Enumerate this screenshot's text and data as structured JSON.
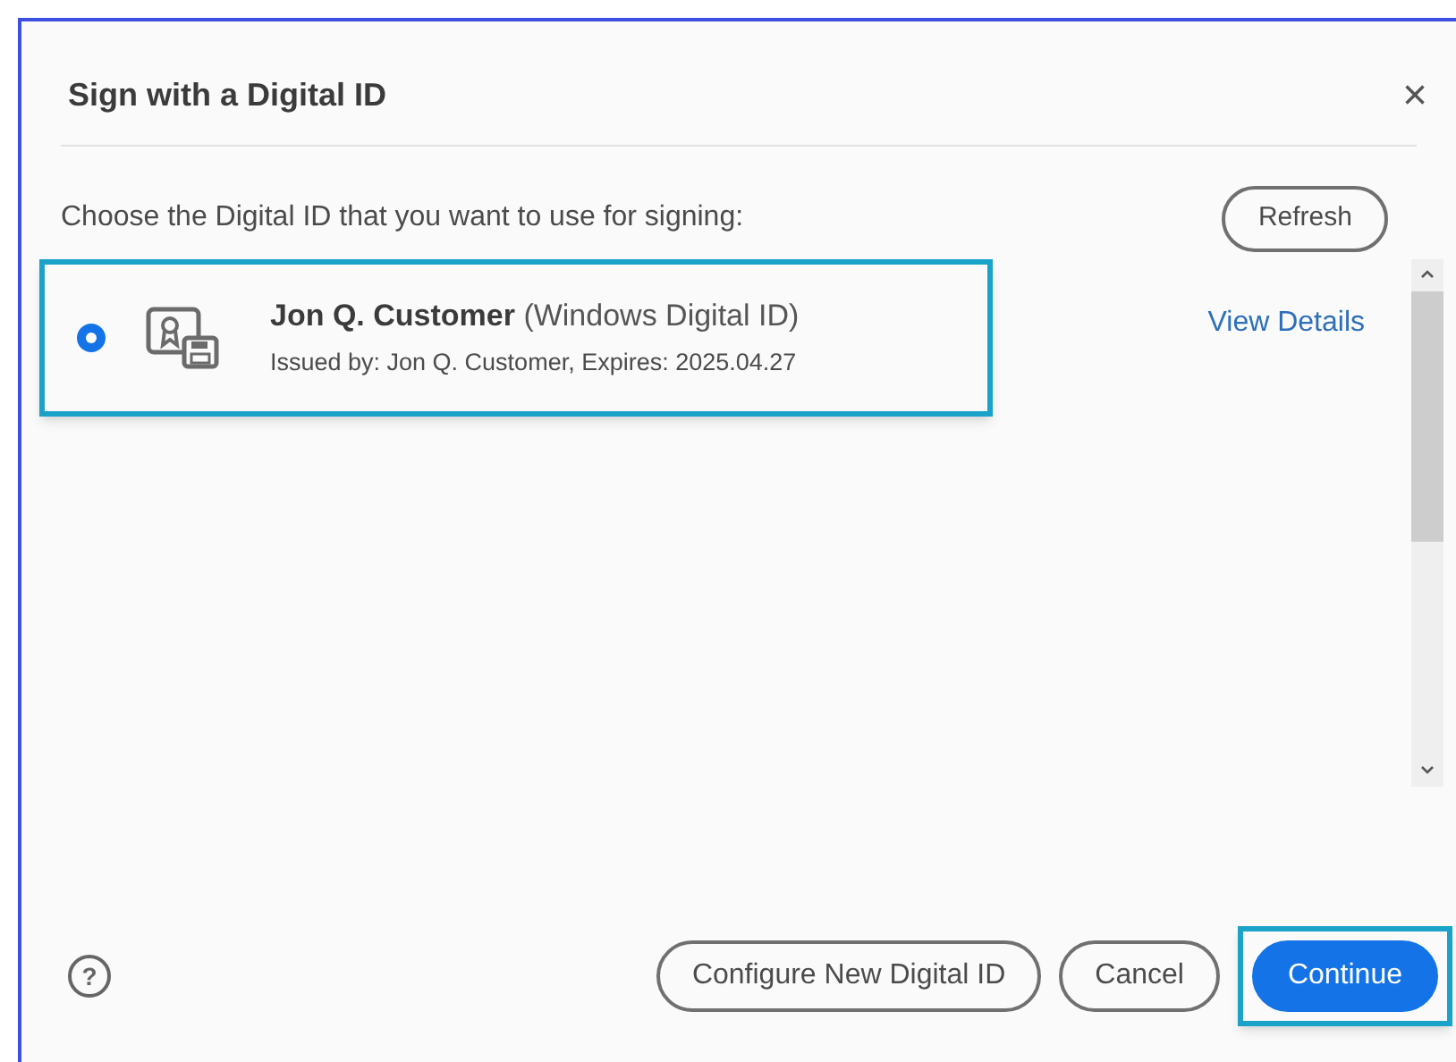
{
  "dialog": {
    "title": "Sign with a Digital ID",
    "close": "×"
  },
  "prompt": "Choose the Digital ID that you want to use for signing:",
  "refresh_button": "Refresh",
  "ids": [
    {
      "name": "Jon Q. Customer",
      "type": "(Windows Digital ID)",
      "issued": "Issued by: Jon Q. Customer, Expires: 2025.04.27",
      "link": "View Details",
      "selected": true,
      "highlighted": true
    }
  ],
  "footer": {
    "help": "?",
    "buttons": [
      {
        "label": "Configure New Digital ID",
        "kind": "secondary",
        "highlighted": false
      },
      {
        "label": "Cancel",
        "kind": "secondary",
        "highlighted": false
      },
      {
        "label": "Continue",
        "kind": "primary",
        "highlighted": true
      }
    ]
  }
}
